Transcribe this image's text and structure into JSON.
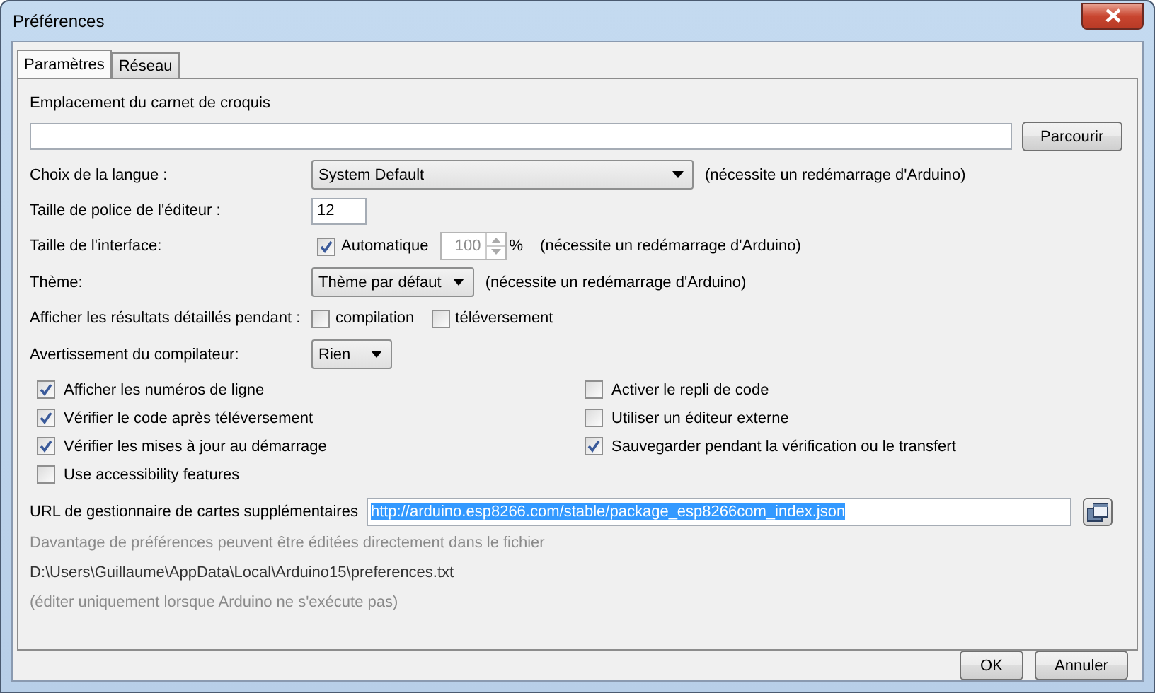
{
  "window": {
    "title": "Préférences"
  },
  "tabs": [
    {
      "label": "Paramètres",
      "selected": true
    },
    {
      "label": "Réseau",
      "selected": false
    }
  ],
  "sketchbook": {
    "label": "Emplacement du carnet de croquis",
    "button": "Parcourir"
  },
  "settings": [
    {
      "kind": "select",
      "label": "Choix de la langue :",
      "value": "System Default",
      "wide": true,
      "note": "(nécessite un redémarrage d'Arduino)"
    },
    {
      "kind": "text",
      "label": "Taille de police de l'éditeur :",
      "value": "12"
    },
    {
      "kind": "scale",
      "label": "Taille de l'interface:",
      "checkbox_label": "Automatique",
      "checked": true,
      "value": "100",
      "disabled": true,
      "unit": "%",
      "note": "(nécessite un redémarrage d'Arduino)"
    },
    {
      "kind": "select",
      "label": "Thème:",
      "value": "Thème par défaut",
      "wide": false,
      "note": "(nécessite un redémarrage d'Arduino)"
    },
    {
      "kind": "checks",
      "label": "Afficher les résultats détaillés pendant :",
      "options": [
        {
          "label": "compilation",
          "checked": false
        },
        {
          "label": "téléversement",
          "checked": false
        }
      ]
    },
    {
      "kind": "select",
      "label": "Avertissement du compilateur:",
      "value": "Rien",
      "wide": false
    }
  ],
  "options_left": [
    {
      "label": "Afficher les numéros de ligne",
      "checked": true
    },
    {
      "label": "Vérifier le code après téléversement",
      "checked": true
    },
    {
      "label": "Vérifier les mises à jour au démarrage",
      "checked": true
    },
    {
      "label": "Use accessibility features",
      "checked": false
    }
  ],
  "options_right": [
    {
      "label": "Activer le repli de code",
      "checked": false
    },
    {
      "label": "Utiliser un éditeur externe",
      "checked": false
    },
    {
      "label": "Sauvegarder pendant la vérification ou le transfert",
      "checked": true
    }
  ],
  "boards_url": {
    "label": "URL de gestionnaire de cartes supplémentaires",
    "value": "http://arduino.esp8266.com/stable/package_esp8266com_index.json"
  },
  "info": [
    {
      "kind": "hint",
      "text": "Davantage de préférences peuvent être éditées directement dans le fichier"
    },
    {
      "kind": "path",
      "text": "D:\\Users\\Guillaume\\AppData\\Local\\Arduino15\\preferences.txt"
    },
    {
      "kind": "hint",
      "text": "(éditer uniquement lorsque Arduino ne s'exécute pas)"
    }
  ],
  "buttons": [
    {
      "label": "OK"
    },
    {
      "label": "Annuler"
    }
  ]
}
